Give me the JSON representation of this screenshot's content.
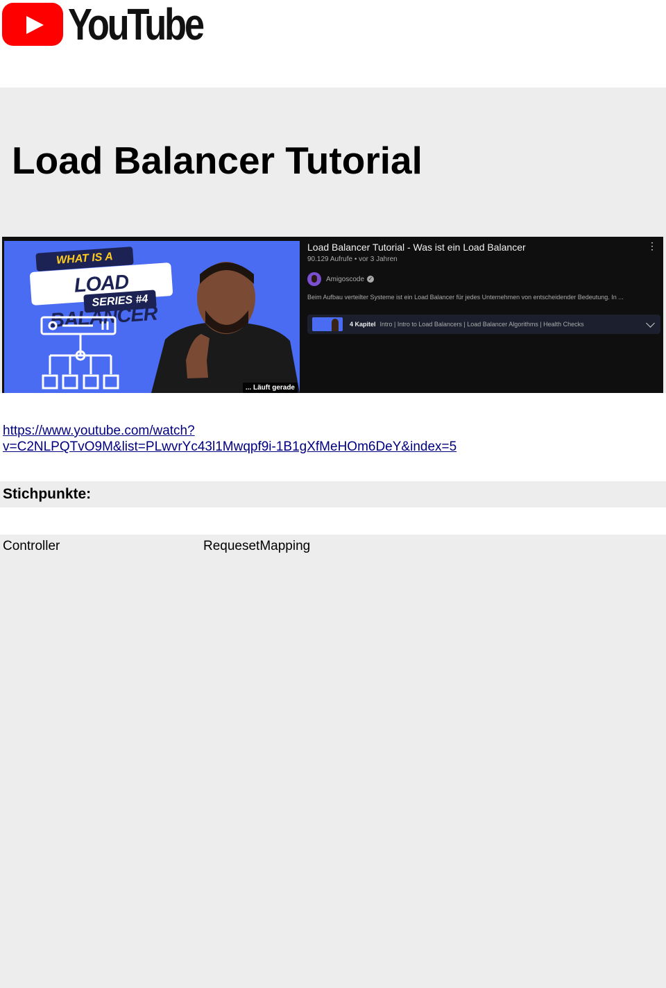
{
  "header": {
    "logo_text": "YouTube"
  },
  "page": {
    "title": "Load Balancer Tutorial"
  },
  "video": {
    "thumbnail": {
      "tag_what": "WHAT IS A",
      "tag_main": "LOAD BALANCER",
      "tag_series": "SERIES  #4",
      "status": "... Läuft gerade"
    },
    "title": "Load Balancer Tutorial - Was ist ein Load Balancer",
    "meta": "90.129 Aufrufe • vor 3 Jahren",
    "channel": "Amigoscode",
    "description": "Beim Aufbau verteilter Systeme ist ein Load Balancer für jedes Unternehmen von entscheidender Bedeutung. In ...",
    "chapters_count": "4 Kapitel",
    "chapters_list": "Intro | Intro to Load Balancers | Load Balancer Algorithms | Health Checks"
  },
  "link": {
    "url": "https://www.youtube.com/watch?v=C2NLPQTvO9M&list=PLwvrYc43l1Mwqpf9i-1B1gXfMeHOm6DeY&index=5",
    "line1": "https://www.youtube.com/watch?",
    "line2": "v=C2NLPQTvO9M&list=PLwvrYc43l1Mwqpf9i-1B1gXfMeHOm6DeY&index=5"
  },
  "notes": {
    "heading": "Stichpunkte:",
    "rows": [
      {
        "col1": "Controller",
        "col2": "RequesetMapping"
      }
    ]
  },
  "colors": {
    "youtube_red": "#ff0000",
    "link": "#000080",
    "card_bg": "#0f0f0f",
    "thumb_bg": "#4a6cf3"
  }
}
